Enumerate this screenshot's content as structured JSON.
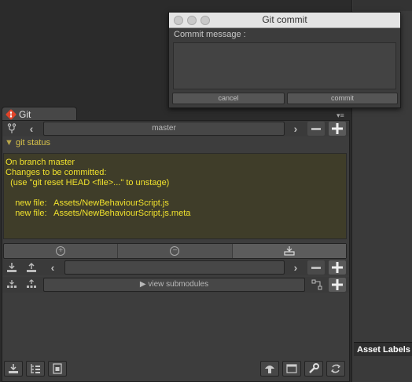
{
  "git_tab": {
    "label": "Git"
  },
  "branch_bar": {
    "branch": "master"
  },
  "status": {
    "header": "git status",
    "text": "On branch master\nChanges to be committed:\n  (use \"git reset HEAD <file>...\" to unstage)\n\n    new file:   Assets/NewBehaviourScript.js\n    new file:   Assets/NewBehaviourScript.js.meta"
  },
  "submodules": {
    "label": "▶ view submodules"
  },
  "commit_dialog": {
    "title": "Git commit",
    "message_label": "Commit message :",
    "message_value": "",
    "cancel_label": "cancel",
    "commit_label": "commit"
  },
  "right_panel": {
    "asset_labels": "Asset Labels"
  },
  "colors": {
    "status_text": "#f1e22d",
    "status_header": "#d7c24a",
    "status_bg": "#3f3d29",
    "panel_bg": "#3d3d3d",
    "git_logo": "#e0442a"
  },
  "icons": [
    "git-logo-icon",
    "branch-icon",
    "chevron-left-icon",
    "chevron-right-icon",
    "minus-icon",
    "plus-icon",
    "add-circle-icon",
    "remove-circle-icon",
    "commit-icon",
    "pull-icon",
    "push-icon",
    "fetch-icon",
    "merge-icon",
    "submodule-icon",
    "log-icon",
    "stash-icon",
    "terminal-icon",
    "settings-wrench-icon",
    "refresh-icon",
    "menu-icon"
  ]
}
